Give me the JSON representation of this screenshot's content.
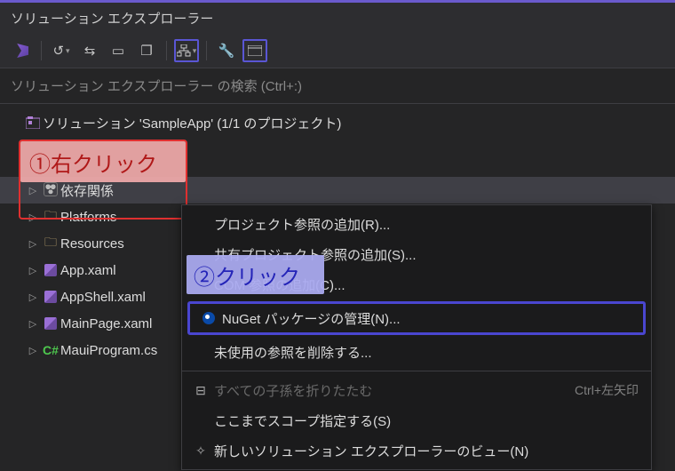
{
  "panel_title": "ソリューション エクスプローラー",
  "search_placeholder": "ソリューション エクスプローラー の検索 (Ctrl+:)",
  "toolbar": {
    "home_tip": "home",
    "history_tip": "history",
    "sync_tip": "sync",
    "collapse_tip": "collapse",
    "copy_tip": "copy",
    "hierarchy_tip": "hierarchy",
    "props_tip": "properties",
    "preview_tip": "preview"
  },
  "tree": {
    "solution": "ソリューション 'SampleApp' (1/1 のプロジェクト)",
    "items": [
      {
        "label": "依存関係",
        "kind": "dep"
      },
      {
        "label": "Platforms",
        "kind": "folder"
      },
      {
        "label": "Resources",
        "kind": "folder"
      },
      {
        "label": "App.xaml",
        "kind": "xaml"
      },
      {
        "label": "AppShell.xaml",
        "kind": "xaml"
      },
      {
        "label": "MainPage.xaml",
        "kind": "xaml"
      },
      {
        "label": "MauiProgram.cs",
        "kind": "cs"
      }
    ]
  },
  "callouts": {
    "c1": "①右クリック",
    "c2": "②クリック"
  },
  "context_menu": {
    "items": [
      {
        "label": "プロジェクト参照の追加(R)...",
        "icon": ""
      },
      {
        "label": "共有プロジェクト参照の追加(S)...",
        "icon": ""
      },
      {
        "label": "COM 参照の追加(C)...",
        "icon": ""
      },
      {
        "label": "NuGet パッケージの管理(N)...",
        "icon": "nuget",
        "highlight": true
      },
      {
        "label": "未使用の参照を削除する...",
        "icon": ""
      },
      {
        "sep": true
      },
      {
        "label": "すべての子孫を折りたたむ",
        "icon": "collapse",
        "shortcut": "Ctrl+左矢印",
        "disabled": true
      },
      {
        "label": "ここまでスコープ指定する(S)",
        "icon": ""
      },
      {
        "label": "新しいソリューション エクスプローラーのビュー(N)",
        "icon": "newview"
      }
    ]
  }
}
